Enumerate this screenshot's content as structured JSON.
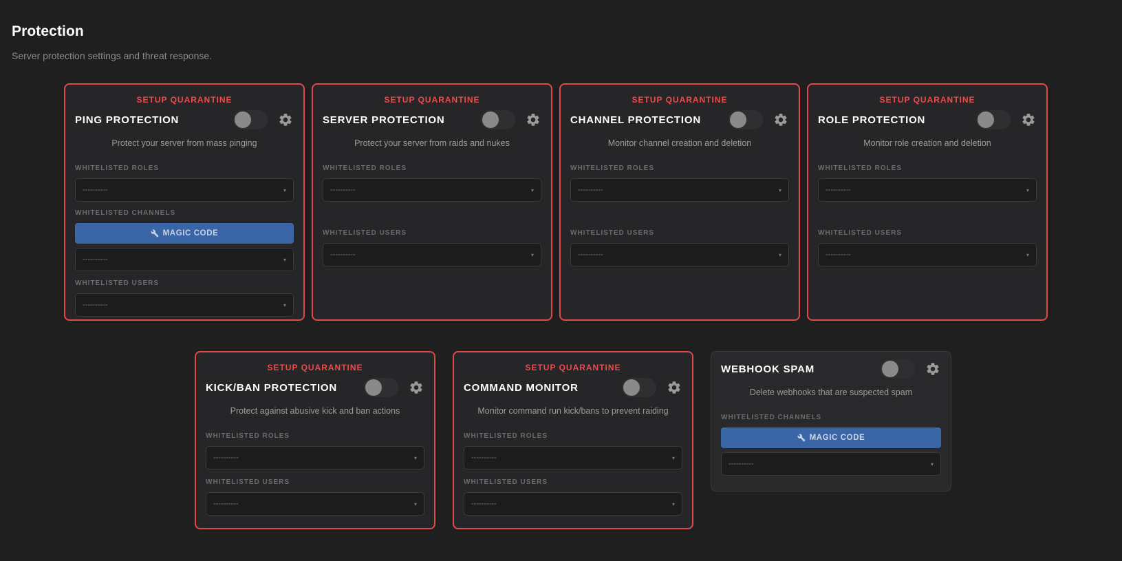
{
  "page": {
    "title": "Protection",
    "subtitle": "Server protection settings and threat response."
  },
  "colors": {
    "background": "#1f1f20",
    "card_border_active": "#e24a4a",
    "quarantine_text": "#ef4b4b",
    "magic_button": "#3a66a7"
  },
  "common": {
    "quarantine_label": "SETUP QUARANTINE",
    "whitelisted_roles": "WHITELISTED ROLES",
    "whitelisted_users": "WHITELISTED USERS",
    "whitelisted_channels": "WHITELISTED CHANNELS",
    "magic_code": "MAGIC CODE",
    "empty_select": "----------",
    "caret": "▾"
  },
  "cards": [
    {
      "title": "PING PROTECTION",
      "description": "Protect your server from mass pinging",
      "enabled": false
    },
    {
      "title": "SERVER PROTECTION",
      "description": "Protect your server from raids and nukes",
      "enabled": false
    },
    {
      "title": "CHANNEL PROTECTION",
      "description": "Monitor channel creation and deletion",
      "enabled": false
    },
    {
      "title": "ROLE PROTECTION",
      "description": "Monitor role creation and deletion",
      "enabled": false
    },
    {
      "title": "KICK/BAN PROTECTION",
      "description": "Protect against abusive kick and ban actions",
      "enabled": false
    },
    {
      "title": "COMMAND MONITOR",
      "description": "Monitor command run kick/bans to prevent raiding",
      "enabled": false
    },
    {
      "title": "WEBHOOK SPAM",
      "description": "Delete webhooks that are suspected spam",
      "enabled": false
    }
  ]
}
